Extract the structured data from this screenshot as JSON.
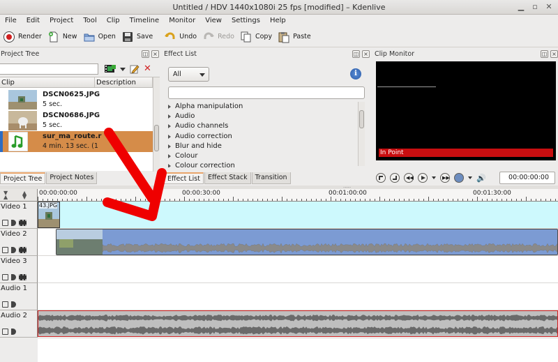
{
  "window": {
    "title": "Untitled / HDV 1440x1080i 25 fps [modified] – Kdenlive"
  },
  "menu": [
    "File",
    "Edit",
    "Project",
    "Tool",
    "Clip",
    "Timeline",
    "Monitor",
    "View",
    "Settings",
    "Help"
  ],
  "toolbar": {
    "render": "Render",
    "new": "New",
    "open": "Open",
    "save": "Save",
    "undo": "Undo",
    "redo": "Redo",
    "copy": "Copy",
    "paste": "Paste"
  },
  "project_tree": {
    "title": "Project Tree",
    "columns": [
      "Clip",
      "Description"
    ],
    "clips": [
      {
        "name": "DSCN0625.JPG",
        "duration": "5 sec.",
        "icon": "image-thumbnail"
      },
      {
        "name": "DSCN0686.JPG",
        "duration": "5 sec.",
        "icon": "image-thumbnail"
      },
      {
        "name": "sur_ma_route.r",
        "duration": "4 min. 13 sec. (1",
        "icon": "music-note-icon",
        "selected": true
      }
    ],
    "tabs": [
      "Project Tree",
      "Project Notes"
    ]
  },
  "effect_list": {
    "title": "Effect List",
    "filter_value": "All",
    "categories": [
      "Alpha manipulation",
      "Audio",
      "Audio channels",
      "Audio correction",
      "Blur and hide",
      "Colour",
      "Colour correction"
    ],
    "tabs": [
      "Effect List",
      "Effect Stack",
      "Transition"
    ]
  },
  "clip_monitor": {
    "title": "Clip Monitor",
    "in_point_label": "In Point",
    "timecode": "00:00:00:00"
  },
  "timeline": {
    "ruler_labels": [
      "00:00:00:00",
      "00:00:30:00",
      "00:01:00:00",
      "00:01:30:00"
    ],
    "tracks": [
      {
        "name": "Video 1",
        "type": "video"
      },
      {
        "name": "Video 2",
        "type": "video"
      },
      {
        "name": "Video 3",
        "type": "video"
      },
      {
        "name": "Audio 1",
        "type": "audio"
      },
      {
        "name": "Audio 2",
        "type": "audio"
      }
    ],
    "image_clip_label": "43.JPG"
  },
  "colors": {
    "selection": "#d58c49",
    "in_point": "#c80e10",
    "video1_lane": "#cdf9fd",
    "video_clip": "#7c9bd3",
    "annotation_arrow": "#ef0000"
  }
}
